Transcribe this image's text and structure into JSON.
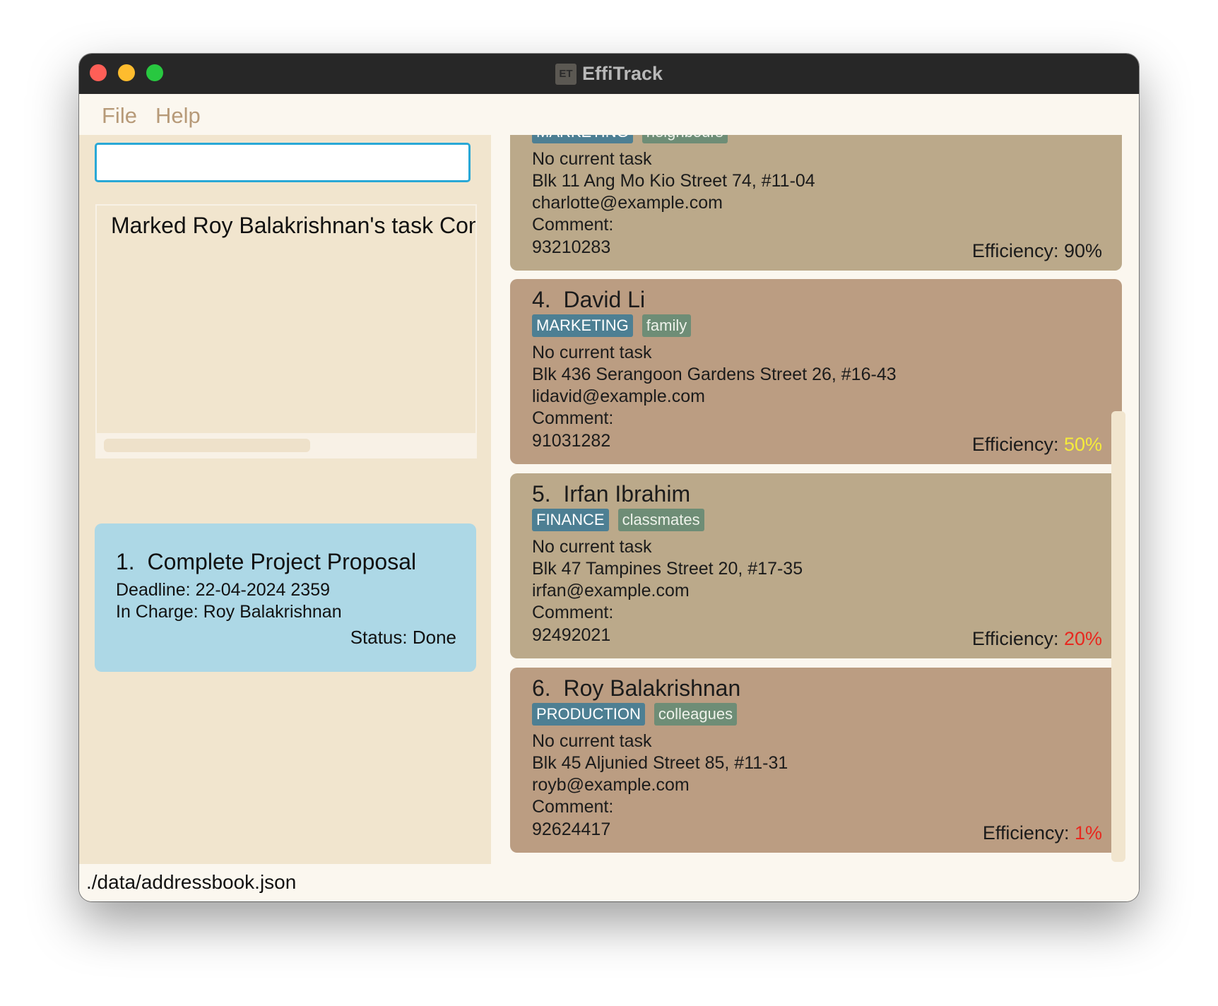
{
  "window": {
    "title": "EffiTrack",
    "app_icon_text": "ET"
  },
  "menu": {
    "items": [
      "File",
      "Help"
    ]
  },
  "command": {
    "value": "",
    "placeholder": ""
  },
  "result": {
    "text": "Marked Roy Balakrishnan's task Completed"
  },
  "tasks": [
    {
      "index": "1.",
      "title": "Complete Project Proposal",
      "deadline": "Deadline: 22-04-2024 2359",
      "in_charge": "In Charge: Roy Balakrishnan",
      "status": "Status: Done"
    }
  ],
  "persons": [
    {
      "index": "",
      "name": "",
      "department": "MARKETING",
      "group": "neighbours",
      "task": "No current task",
      "address": "Blk 11 Ang Mo Kio Street 74, #11-04",
      "email": "charlotte@example.com",
      "comment": "Comment:",
      "phone": "93210283",
      "efficiency_label": "Efficiency: ",
      "efficiency_value": "90%",
      "efficiency_color": "#1b1b1b"
    },
    {
      "index": "4.",
      "name": "David Li",
      "department": "MARKETING",
      "group": "family",
      "task": "No current task",
      "address": "Blk 436 Serangoon Gardens Street 26, #16-43",
      "email": "lidavid@example.com",
      "comment": "Comment:",
      "phone": "91031282",
      "efficiency_label": "Efficiency: ",
      "efficiency_value": "50%",
      "efficiency_color": "#f6ec3a"
    },
    {
      "index": "5.",
      "name": "Irfan Ibrahim",
      "department": "FINANCE",
      "group": "classmates",
      "task": "No current task",
      "address": "Blk 47 Tampines Street 20, #17-35",
      "email": "irfan@example.com",
      "comment": "Comment:",
      "phone": "92492021",
      "efficiency_label": "Efficiency: ",
      "efficiency_value": "20%",
      "efficiency_color": "#e8281f"
    },
    {
      "index": "6.",
      "name": "Roy Balakrishnan",
      "department": "PRODUCTION",
      "group": "colleagues",
      "task": "No current task",
      "address": "Blk 45 Aljunied Street 85, #11-31",
      "email": "royb@example.com",
      "comment": "Comment:",
      "phone": "92624417",
      "efficiency_label": "Efficiency: ",
      "efficiency_value": "1%",
      "efficiency_color": "#e8281f"
    }
  ],
  "status_bar": {
    "path": "./data/addressbook.json"
  }
}
